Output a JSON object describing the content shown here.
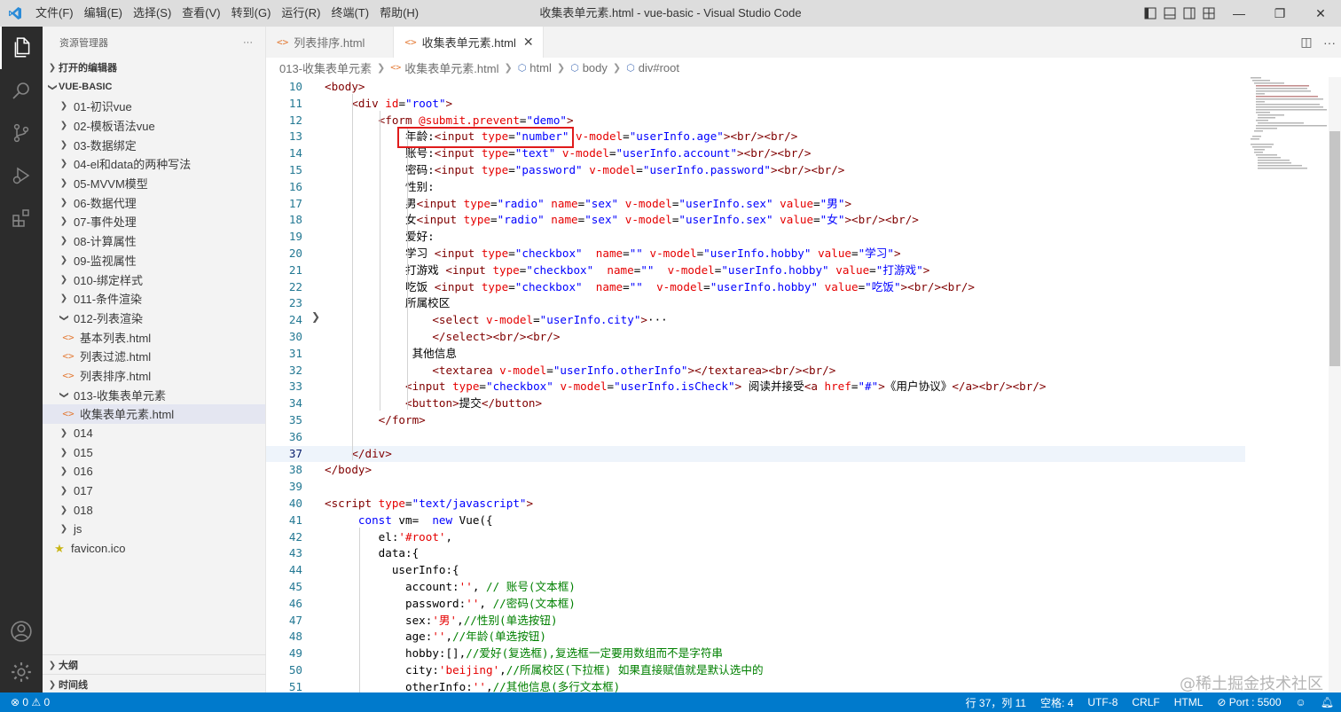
{
  "window": {
    "title": "收集表单元素.html - vue-basic - Visual Studio Code",
    "menu": [
      "文件(F)",
      "编辑(E)",
      "选择(S)",
      "查看(V)",
      "转到(G)",
      "运行(R)",
      "终端(T)",
      "帮助(H)"
    ]
  },
  "sidebar": {
    "header": "资源管理器",
    "more": "···",
    "open_editors": "打开的编辑器",
    "project": "VUE-BASIC",
    "tree": [
      {
        "label": "01-初识vue",
        "type": "folder"
      },
      {
        "label": "02-模板语法vue",
        "type": "folder"
      },
      {
        "label": "03-数据绑定",
        "type": "folder"
      },
      {
        "label": "04-el和data的两种写法",
        "type": "folder"
      },
      {
        "label": "05-MVVM模型",
        "type": "folder"
      },
      {
        "label": "06-数据代理",
        "type": "folder"
      },
      {
        "label": "07-事件处理",
        "type": "folder"
      },
      {
        "label": "08-计算属性",
        "type": "folder"
      },
      {
        "label": "09-监视属性",
        "type": "folder"
      },
      {
        "label": "010-绑定样式",
        "type": "folder"
      },
      {
        "label": "011-条件渲染",
        "type": "folder"
      },
      {
        "label": "012-列表渲染",
        "type": "folder-open"
      },
      {
        "label": "基本列表.html",
        "type": "file"
      },
      {
        "label": "列表过滤.html",
        "type": "file"
      },
      {
        "label": "列表排序.html",
        "type": "file"
      },
      {
        "label": "013-收集表单元素",
        "type": "folder-open"
      },
      {
        "label": "收集表单元素.html",
        "type": "file-selected"
      },
      {
        "label": "014",
        "type": "folder"
      },
      {
        "label": "015",
        "type": "folder"
      },
      {
        "label": "016",
        "type": "folder"
      },
      {
        "label": "017",
        "type": "folder"
      },
      {
        "label": "018",
        "type": "folder"
      },
      {
        "label": "js",
        "type": "folder"
      },
      {
        "label": "favicon.ico",
        "type": "star"
      }
    ],
    "outline": "大纲",
    "timeline": "时间线"
  },
  "tabs": [
    {
      "label": "列表排序.html",
      "active": false
    },
    {
      "label": "收集表单元素.html",
      "active": true
    }
  ],
  "breadcrumb": [
    "013-收集表单元素",
    "收集表单元素.html",
    "html",
    "body",
    "div#root"
  ],
  "editor": {
    "current_line": 37,
    "lines": [
      {
        "n": "10",
        "code": [
          [
            "t",
            "<body>"
          ]
        ]
      },
      {
        "n": "11",
        "code": [
          [
            "p",
            "    "
          ],
          [
            "t",
            "<div "
          ],
          [
            "a",
            "id"
          ],
          [
            "p",
            "="
          ],
          [
            "s",
            "\"root\""
          ],
          [
            "t",
            ">"
          ]
        ]
      },
      {
        "n": "12",
        "code": [
          [
            "p",
            "        "
          ],
          [
            "t",
            "<form "
          ],
          [
            "a",
            "@submit.prevent"
          ],
          [
            "p",
            "="
          ],
          [
            "s",
            "\"demo\""
          ],
          [
            "t",
            ">"
          ]
        ]
      },
      {
        "n": "13",
        "code": [
          [
            "p",
            "            年龄:"
          ],
          [
            "t",
            "<input "
          ],
          [
            "a",
            "type"
          ],
          [
            "p",
            "="
          ],
          [
            "s",
            "\"number\""
          ],
          [
            "p",
            " "
          ],
          [
            "a",
            "v-model"
          ],
          [
            "p",
            "="
          ],
          [
            "s",
            "\"userInfo.age\""
          ],
          [
            "t",
            ">"
          ],
          [
            "t",
            "<br/><br/>"
          ]
        ]
      },
      {
        "n": "14",
        "code": [
          [
            "p",
            "            账号:"
          ],
          [
            "t",
            "<input "
          ],
          [
            "a",
            "type"
          ],
          [
            "p",
            "="
          ],
          [
            "s",
            "\"text\""
          ],
          [
            "p",
            " "
          ],
          [
            "a",
            "v-model"
          ],
          [
            "p",
            "="
          ],
          [
            "s",
            "\"userInfo.account\""
          ],
          [
            "t",
            ">"
          ],
          [
            "t",
            "<br/><br/>"
          ]
        ]
      },
      {
        "n": "15",
        "code": [
          [
            "p",
            "            密码:"
          ],
          [
            "t",
            "<input "
          ],
          [
            "a",
            "type"
          ],
          [
            "p",
            "="
          ],
          [
            "s",
            "\"password\""
          ],
          [
            "p",
            " "
          ],
          [
            "a",
            "v-model"
          ],
          [
            "p",
            "="
          ],
          [
            "s",
            "\"userInfo.password\""
          ],
          [
            "t",
            ">"
          ],
          [
            "t",
            "<br/><br/>"
          ]
        ]
      },
      {
        "n": "16",
        "code": [
          [
            "p",
            "            性别:"
          ]
        ]
      },
      {
        "n": "17",
        "code": [
          [
            "p",
            "            男"
          ],
          [
            "t",
            "<input "
          ],
          [
            "a",
            "type"
          ],
          [
            "p",
            "="
          ],
          [
            "s",
            "\"radio\""
          ],
          [
            "p",
            " "
          ],
          [
            "a",
            "name"
          ],
          [
            "p",
            "="
          ],
          [
            "s",
            "\"sex\""
          ],
          [
            "p",
            " "
          ],
          [
            "a",
            "v-model"
          ],
          [
            "p",
            "="
          ],
          [
            "s",
            "\"userInfo.sex\""
          ],
          [
            "p",
            " "
          ],
          [
            "a",
            "value"
          ],
          [
            "p",
            "="
          ],
          [
            "s",
            "\"男\""
          ],
          [
            "t",
            ">"
          ]
        ]
      },
      {
        "n": "18",
        "code": [
          [
            "p",
            "            女"
          ],
          [
            "t",
            "<input "
          ],
          [
            "a",
            "type"
          ],
          [
            "p",
            "="
          ],
          [
            "s",
            "\"radio\""
          ],
          [
            "p",
            " "
          ],
          [
            "a",
            "name"
          ],
          [
            "p",
            "="
          ],
          [
            "s",
            "\"sex\""
          ],
          [
            "p",
            " "
          ],
          [
            "a",
            "v-model"
          ],
          [
            "p",
            "="
          ],
          [
            "s",
            "\"userInfo.sex\""
          ],
          [
            "p",
            " "
          ],
          [
            "a",
            "value"
          ],
          [
            "p",
            "="
          ],
          [
            "s",
            "\"女\""
          ],
          [
            "t",
            ">"
          ],
          [
            "t",
            "<br/><br/>"
          ]
        ]
      },
      {
        "n": "19",
        "code": [
          [
            "p",
            "            爱好:"
          ]
        ]
      },
      {
        "n": "20",
        "code": [
          [
            "p",
            "            学习 "
          ],
          [
            "t",
            "<input "
          ],
          [
            "a",
            "type"
          ],
          [
            "p",
            "="
          ],
          [
            "s",
            "\"checkbox\""
          ],
          [
            "p",
            "  "
          ],
          [
            "a",
            "name"
          ],
          [
            "p",
            "="
          ],
          [
            "s",
            "\"\""
          ],
          [
            "p",
            " "
          ],
          [
            "a",
            "v-model"
          ],
          [
            "p",
            "="
          ],
          [
            "s",
            "\"userInfo.hobby\""
          ],
          [
            "p",
            " "
          ],
          [
            "a",
            "value"
          ],
          [
            "p",
            "="
          ],
          [
            "s",
            "\"学习\""
          ],
          [
            "t",
            ">"
          ]
        ]
      },
      {
        "n": "21",
        "code": [
          [
            "p",
            "            打游戏 "
          ],
          [
            "t",
            "<input "
          ],
          [
            "a",
            "type"
          ],
          [
            "p",
            "="
          ],
          [
            "s",
            "\"checkbox\""
          ],
          [
            "p",
            "  "
          ],
          [
            "a",
            "name"
          ],
          [
            "p",
            "="
          ],
          [
            "s",
            "\"\""
          ],
          [
            "p",
            "  "
          ],
          [
            "a",
            "v-model"
          ],
          [
            "p",
            "="
          ],
          [
            "s",
            "\"userInfo.hobby\""
          ],
          [
            "p",
            " "
          ],
          [
            "a",
            "value"
          ],
          [
            "p",
            "="
          ],
          [
            "s",
            "\"打游戏\""
          ],
          [
            "t",
            ">"
          ]
        ]
      },
      {
        "n": "22",
        "code": [
          [
            "p",
            "            吃饭 "
          ],
          [
            "t",
            "<input "
          ],
          [
            "a",
            "type"
          ],
          [
            "p",
            "="
          ],
          [
            "s",
            "\"checkbox\""
          ],
          [
            "p",
            "  "
          ],
          [
            "a",
            "name"
          ],
          [
            "p",
            "="
          ],
          [
            "s",
            "\"\""
          ],
          [
            "p",
            "  "
          ],
          [
            "a",
            "v-model"
          ],
          [
            "p",
            "="
          ],
          [
            "s",
            "\"userInfo.hobby\""
          ],
          [
            "p",
            " "
          ],
          [
            "a",
            "value"
          ],
          [
            "p",
            "="
          ],
          [
            "s",
            "\"吃饭\""
          ],
          [
            "t",
            ">"
          ],
          [
            "t",
            "<br/><br/>"
          ]
        ]
      },
      {
        "n": "23",
        "code": [
          [
            "p",
            "            所属校区"
          ]
        ]
      },
      {
        "n": "24",
        "code": [
          [
            "p",
            "                "
          ],
          [
            "t",
            "<select "
          ],
          [
            "a",
            "v-model"
          ],
          [
            "p",
            "="
          ],
          [
            "s",
            "\"userInfo.city\""
          ],
          [
            "t",
            ">"
          ],
          [
            "p",
            "···"
          ]
        ]
      },
      {
        "n": "30",
        "code": [
          [
            "p",
            "                "
          ],
          [
            "t",
            "</select>"
          ],
          [
            "t",
            "<br/><br/>"
          ]
        ]
      },
      {
        "n": "31",
        "code": [
          [
            "p",
            "             其他信息"
          ]
        ]
      },
      {
        "n": "32",
        "code": [
          [
            "p",
            "                "
          ],
          [
            "t",
            "<textarea "
          ],
          [
            "a",
            "v-model"
          ],
          [
            "p",
            "="
          ],
          [
            "s",
            "\"userInfo.otherInfo\""
          ],
          [
            "t",
            ">"
          ],
          [
            "t",
            "</textarea>"
          ],
          [
            "t",
            "<br/><br/>"
          ]
        ]
      },
      {
        "n": "33",
        "code": [
          [
            "p",
            "            "
          ],
          [
            "t",
            "<input "
          ],
          [
            "a",
            "type"
          ],
          [
            "p",
            "="
          ],
          [
            "s",
            "\"checkbox\""
          ],
          [
            "p",
            " "
          ],
          [
            "a",
            "v-model"
          ],
          [
            "p",
            "="
          ],
          [
            "s",
            "\"userInfo.isCheck\""
          ],
          [
            "t",
            ">"
          ],
          [
            "p",
            " 阅读并接受"
          ],
          [
            "t",
            "<a "
          ],
          [
            "a",
            "href"
          ],
          [
            "p",
            "="
          ],
          [
            "s",
            "\"#\""
          ],
          [
            "t",
            ">"
          ],
          [
            "p",
            "《用户协议》"
          ],
          [
            "t",
            "</a>"
          ],
          [
            "t",
            "<br/><br/>"
          ]
        ]
      },
      {
        "n": "34",
        "code": [
          [
            "p",
            "            "
          ],
          [
            "t",
            "<button>"
          ],
          [
            "p",
            "提交"
          ],
          [
            "t",
            "</button>"
          ]
        ]
      },
      {
        "n": "35",
        "code": [
          [
            "p",
            "        "
          ],
          [
            "t",
            "</form>"
          ]
        ]
      },
      {
        "n": "36",
        "code": [
          [
            "p",
            ""
          ]
        ]
      },
      {
        "n": "37",
        "code": [
          [
            "p",
            "    "
          ],
          [
            "t",
            "</div>"
          ]
        ]
      },
      {
        "n": "38",
        "code": [
          [
            "t",
            "</body>"
          ]
        ]
      },
      {
        "n": "39",
        "code": [
          [
            "p",
            ""
          ]
        ]
      },
      {
        "n": "40",
        "code": [
          [
            "t",
            "<script "
          ],
          [
            "a",
            "type"
          ],
          [
            "p",
            "="
          ],
          [
            "s",
            "\"text/javascript\""
          ],
          [
            "t",
            ">"
          ]
        ]
      },
      {
        "n": "41",
        "code": [
          [
            "p",
            "     "
          ],
          [
            "k",
            "const"
          ],
          [
            "p",
            " vm=  "
          ],
          [
            "k",
            "new"
          ],
          [
            "p",
            " Vue({"
          ]
        ]
      },
      {
        "n": "42",
        "code": [
          [
            "p",
            "        el:"
          ],
          [
            "a",
            "'#root'"
          ],
          [
            "p",
            ","
          ]
        ]
      },
      {
        "n": "43",
        "code": [
          [
            "p",
            "        data:{"
          ]
        ]
      },
      {
        "n": "44",
        "code": [
          [
            "p",
            "          userInfo:{"
          ]
        ]
      },
      {
        "n": "45",
        "code": [
          [
            "p",
            "            account:"
          ],
          [
            "a",
            "''"
          ],
          [
            "p",
            ", "
          ],
          [
            "c",
            "// 账号(文本框)"
          ]
        ]
      },
      {
        "n": "46",
        "code": [
          [
            "p",
            "            password:"
          ],
          [
            "a",
            "''"
          ],
          [
            "p",
            ", "
          ],
          [
            "c",
            "//密码(文本框)"
          ]
        ]
      },
      {
        "n": "47",
        "code": [
          [
            "p",
            "            sex:"
          ],
          [
            "a",
            "'男'"
          ],
          [
            "p",
            ","
          ],
          [
            "c",
            "//性别(单选按钮)"
          ]
        ]
      },
      {
        "n": "48",
        "code": [
          [
            "p",
            "            age:"
          ],
          [
            "a",
            "''"
          ],
          [
            "p",
            ","
          ],
          [
            "c",
            "//年龄(单选按钮)"
          ]
        ]
      },
      {
        "n": "49",
        "code": [
          [
            "p",
            "            hobby:[],"
          ],
          [
            "c",
            "//爱好(复选框),复选框一定要用数组而不是字符串"
          ]
        ]
      },
      {
        "n": "50",
        "code": [
          [
            "p",
            "            city:"
          ],
          [
            "a",
            "'beijing'"
          ],
          [
            "p",
            ","
          ],
          [
            "c",
            "//所属校区(下拉框) 如果直接赋值就是默认选中的"
          ]
        ]
      },
      {
        "n": "51",
        "code": [
          [
            "p",
            "            otherInfo:"
          ],
          [
            "a",
            "''"
          ],
          [
            "p",
            ","
          ],
          [
            "c",
            "//其他信息(多行文本框)"
          ]
        ]
      }
    ]
  },
  "statusbar": {
    "problems": "⊗ 0 ⚠ 0",
    "position": "行 37，列 11",
    "spaces": "空格: 4",
    "encoding": "UTF-8",
    "eol": "CRLF",
    "language": "HTML",
    "port": "⊘ Port : 5500"
  },
  "watermark": "@稀土掘金技术社区",
  "colors": {
    "accent": "#007acc",
    "activity_bar": "#2c2c2c",
    "highlight_box": "#e01b1b"
  }
}
